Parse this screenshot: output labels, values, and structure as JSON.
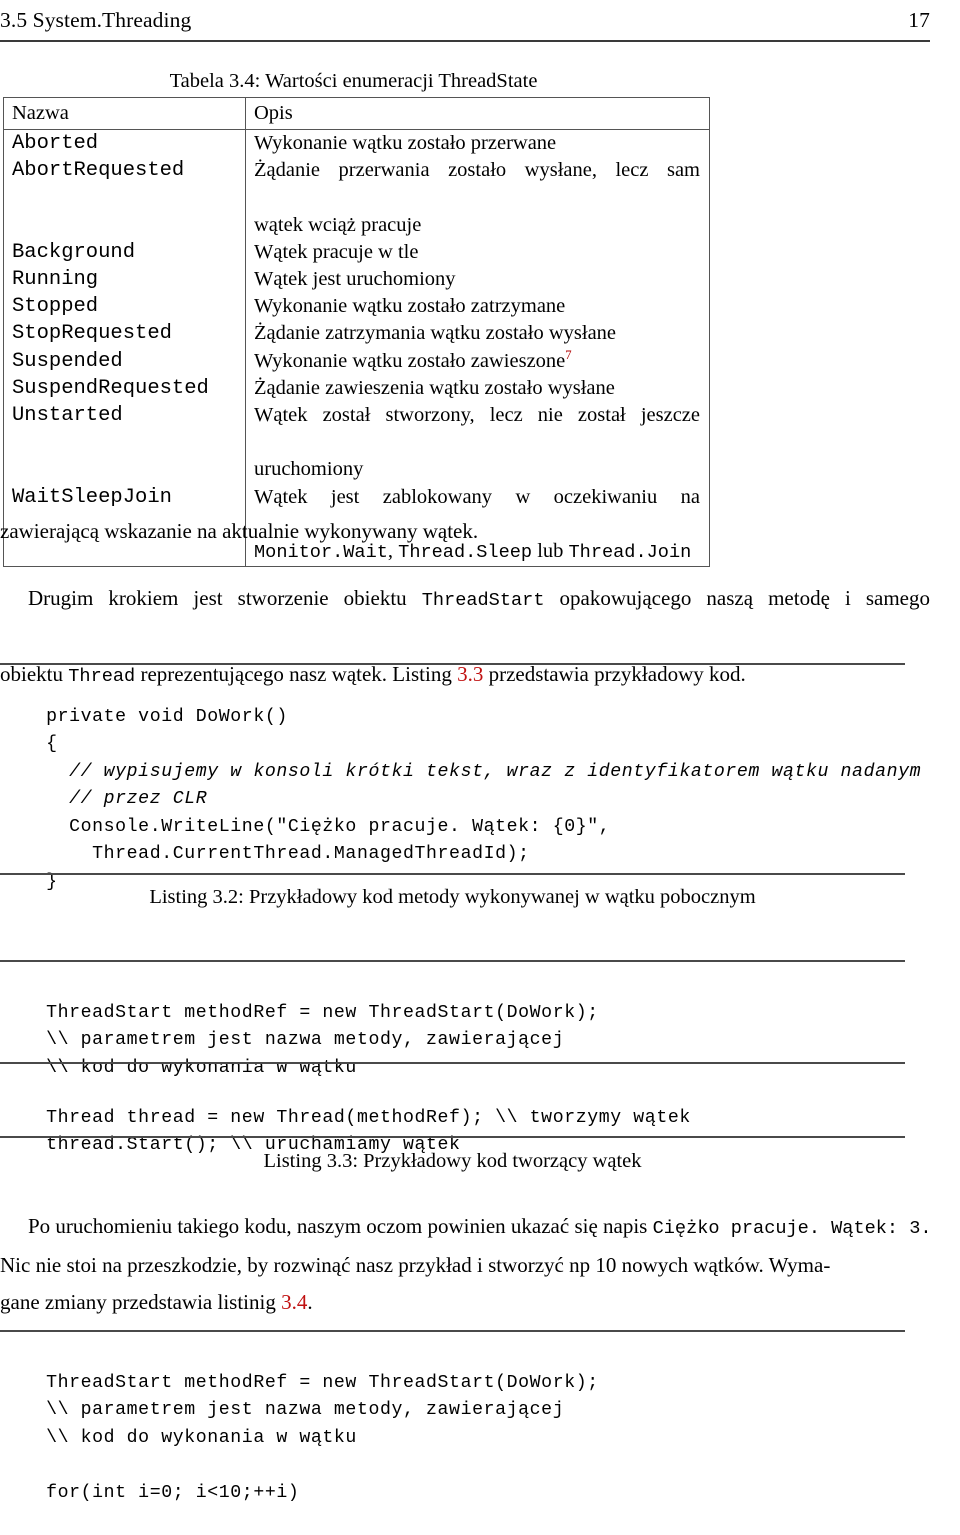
{
  "header": {
    "section_title": "3.5 System.Threading",
    "page_number": "17"
  },
  "table": {
    "caption": "Tabela 3.4: Wartości enumeracji ThreadState",
    "columns": [
      "Nazwa",
      "Opis"
    ],
    "rows": [
      {
        "name": "Aborted",
        "desc_lines": [
          "Wykonanie wątku zostało przerwane"
        ]
      },
      {
        "name": "AbortRequested",
        "desc_lines": [
          "Żądanie przerwania zostało wysłane, lecz sam",
          "wątek wciąż pracuje"
        ]
      },
      {
        "name": "Background",
        "desc_lines": [
          "Wątek pracuje w tle"
        ]
      },
      {
        "name": "Running",
        "desc_lines": [
          "Wątek jest uruchomiony"
        ]
      },
      {
        "name": "Stopped",
        "desc_lines": [
          "Wykonanie wątku zostało zatrzymane"
        ]
      },
      {
        "name": "StopRequested",
        "desc_lines": [
          "Żądanie zatrzymania wątku zostało wysłane"
        ]
      },
      {
        "name": "Suspended",
        "desc_lines": [
          "Wykonanie wątku zostało zawieszone"
        ],
        "footnote": "7"
      },
      {
        "name": "SuspendRequested",
        "desc_lines": [
          "Żądanie zawieszenia wątku zostało wysłane"
        ]
      },
      {
        "name": "Unstarted",
        "desc_lines": [
          "Wątek został stworzony, lecz nie został jeszcze",
          "uruchomiony"
        ]
      },
      {
        "name": "WaitSleepJoin",
        "desc_lines": [
          "Wątek jest zablokowany w oczekiwaniu na"
        ],
        "desc_mixed": {
          "code1": "Monitor.Wait",
          "sep1": ", ",
          "code2": "Thread.Sleep",
          "sep2": " lub ",
          "code3": "Thread.Join"
        }
      }
    ]
  },
  "paragraph1": {
    "line1": "zawierającą wskazanie na aktualnie wykonywany wątek."
  },
  "paragraph2": {
    "line1_a": "Drugim krokiem jest stworzenie obiektu ",
    "line1_code": "ThreadStart",
    "line1_b": " opakowującego naszą metodę i samego",
    "line2_a": "obiektu ",
    "line2_code": "Thread",
    "line2_b": " reprezentującego nasz wątek. Listing ",
    "line2_link": "3.3",
    "line2_c": " przedstawia przykładowy kod."
  },
  "listing32": {
    "code_lines": [
      {
        "text": "private void DoWork()",
        "style": "plain"
      },
      {
        "text": "{",
        "style": "plain"
      },
      {
        "text": "  // wypisujemy w konsoli krótki tekst, wraz z identyfikatorem wątku nadanym",
        "style": "comment"
      },
      {
        "text": "  // przez CLR",
        "style": "comment"
      },
      {
        "text": "  Console.WriteLine(\"Ciężko pracuje. Wątek: {0}\",",
        "style": "plain"
      },
      {
        "text": "    Thread.CurrentThread.ManagedThreadId);",
        "style": "plain"
      },
      {
        "text": "}",
        "style": "plain"
      }
    ],
    "caption": "Listing 3.2: Przykładowy kod metody wykonywanej w wątku pobocznym"
  },
  "listing33": {
    "code_block_a": [
      "ThreadStart methodRef = new ThreadStart(DoWork);",
      "\\\\ parametrem jest nazwa metody, zawierającej",
      "\\\\ kod do wykonania w wątku"
    ],
    "code_block_b": [
      "Thread thread = new Thread(methodRef); \\\\ tworzymy wątek",
      "thread.Start(); \\\\ uruchamiamy wątek"
    ],
    "caption": "Listing 3.3: Przykładowy kod tworzący wątek"
  },
  "paragraph3": {
    "line1_a": "Po uruchomieniu takiego kodu, naszym oczom powinien ukazać się napis ",
    "line1_code": "Ciężko pracuje. Wątek: 3.",
    "line2": "Nic nie stoi na przeszkodzie, by rozwinąć nasz przykład i stworzyć np 10 nowych wątków. Wyma-",
    "line3_a": "gane zmiany przedstawia listinig ",
    "line3_link": "3.4",
    "line3_b": "."
  },
  "listing34": {
    "code_lines": [
      "ThreadStart methodRef = new ThreadStart(DoWork);",
      "\\\\ parametrem jest nazwa metody, zawierającej",
      "\\\\ kod do wykonania w wątku",
      "",
      "for(int i=0; i<10;++i)"
    ]
  },
  "colors": {
    "link": "#c01010",
    "footnote": "#b00000",
    "rule": "#4a4a4a",
    "text": "#000000"
  }
}
